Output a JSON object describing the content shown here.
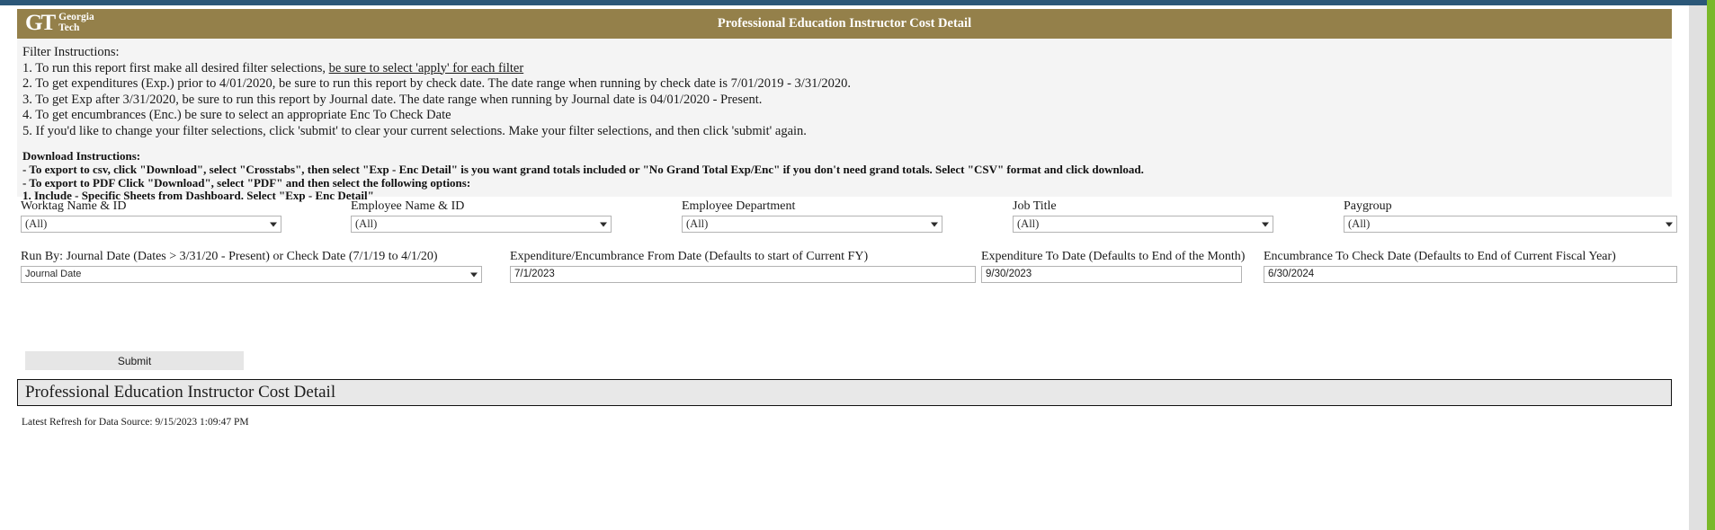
{
  "header": {
    "logo_gt": "GT",
    "logo_line1": "Georgia",
    "logo_line2": "Tech",
    "title": "Professional Education Instructor Cost Detail",
    "banner_color": "#94804a"
  },
  "instructions": {
    "heading": "Filter Instructions:",
    "line1_pre": "1. To run this report first make all desired filter selections, ",
    "line1_underlined": "be sure to select 'apply' for each filter",
    "line2": "2. To get expenditures (Exp.) prior to 4/01/2020, be sure to run this report by check date. The date range when running by check date is 7/01/2019 - 3/31/2020.",
    "line3": "3. To get Exp after 3/31/2020, be sure to run this report by Journal date. The date range when running by Journal date is 04/01/2020 - Present.",
    "line4": "4. To get encumbrances (Enc.) be sure to select an appropriate Enc To Check Date",
    "line5": "5. If you'd like to change your filter selections, click 'submit' to clear your current selections. Make your filter selections, and then click 'submit' again."
  },
  "download_instructions": {
    "heading": "Download Instructions:",
    "line1": "- To export to csv, click \"Download\",  select \"Crosstabs\", then select \"Exp - Enc Detail\" is you want grand totals included or \"No Grand Total Exp/Enc\" if you don't need grand totals. Select \"CSV\" format and click download.",
    "line2": "- To export to PDF Click \"Download\", select \"PDF\" and then select the following options:",
    "line3": "1. Include - Specific Sheets from Dashboard. Select \"Exp - Enc Detail\""
  },
  "filters": {
    "dropdowns": [
      {
        "label": "Worktag Name & ID",
        "value": "(All)"
      },
      {
        "label": "Employee Name & ID",
        "value": "(All)"
      },
      {
        "label": "Employee Department",
        "value": "(All)"
      },
      {
        "label": "Job Title",
        "value": "(All)"
      },
      {
        "label": "Paygroup",
        "value": "(All)"
      }
    ],
    "run_by": {
      "label": "Run By: Journal Date (Dates > 3/31/20 - Present) or Check Date (7/1/19 to 4/1/20)",
      "value": "Journal Date"
    },
    "dates": [
      {
        "label": "Expenditure/Encumbrance From Date (Defaults to start of Current FY)",
        "value": "7/1/2023"
      },
      {
        "label": "Expenditure To Date (Defaults to End of the Month)",
        "value": "9/30/2023"
      },
      {
        "label": "Encumbrance To Check Date (Defaults to End of Current Fiscal Year)",
        "value": "6/30/2024"
      }
    ]
  },
  "actions": {
    "submit_label": "Submit"
  },
  "report": {
    "title": "Professional Education Instructor Cost Detail",
    "refresh_note": "Latest Refresh for Data Source: 9/15/2023 1:09:47 PM"
  }
}
